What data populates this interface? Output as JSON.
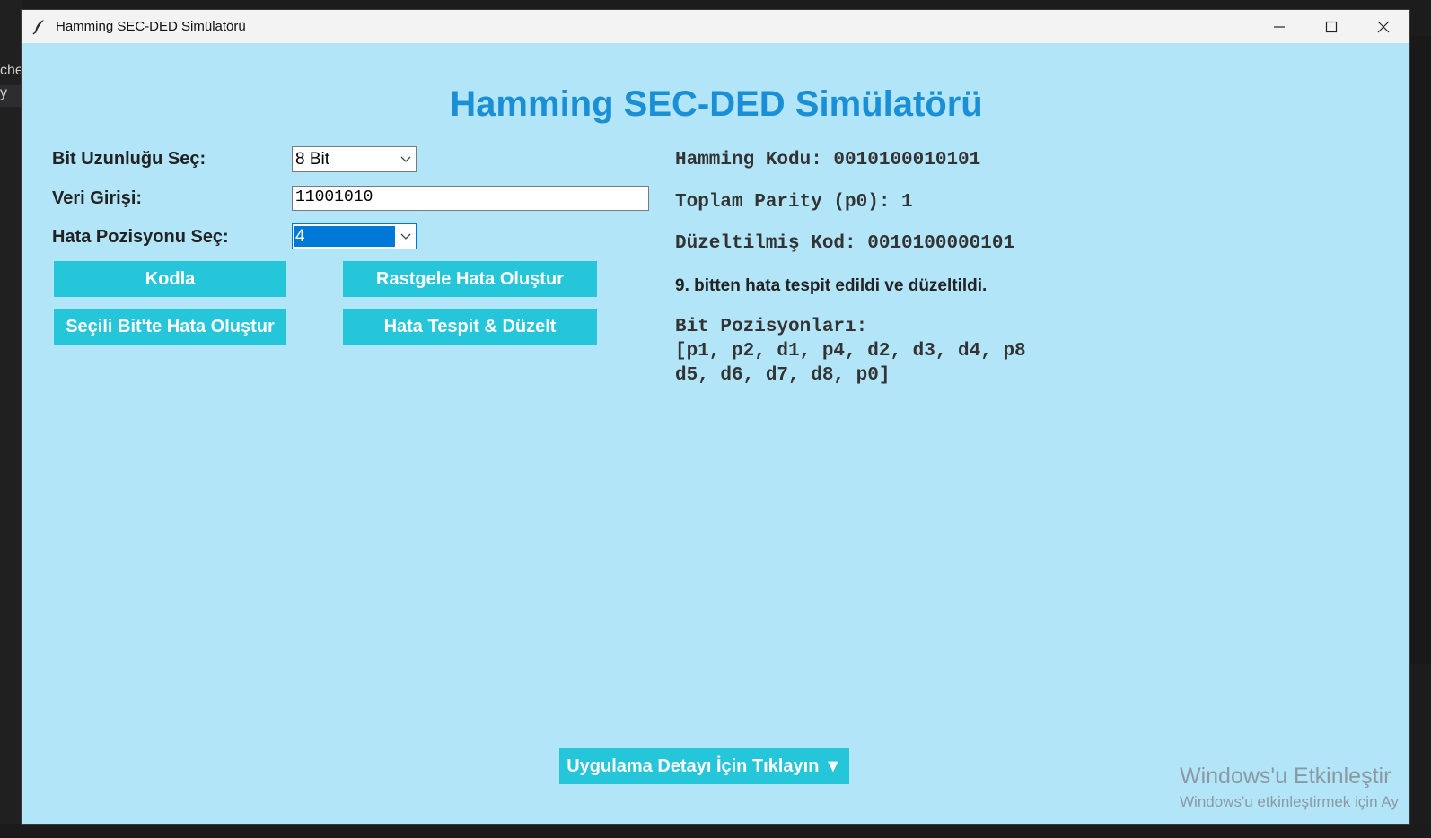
{
  "background": {
    "left_text_1": "che",
    "left_text_2": "y"
  },
  "window": {
    "title": "Hamming SEC-DED Simülatörü"
  },
  "main": {
    "heading": "Hamming SEC-DED Simülatörü",
    "bit_length_label": "Bit Uzunluğu Seç:",
    "bit_length_value": "8 Bit",
    "data_input_label": "Veri Girişi:",
    "data_input_value": "11001010",
    "error_position_label": "Hata Pozisyonu Seç:",
    "error_position_value": "4",
    "buttons": {
      "encode": "Kodla",
      "random_error": "Rastgele Hata Oluştur",
      "selected_bit_error": "Seçili Bit'te Hata Oluştur",
      "detect_correct": "Hata Tespit & Düzelt"
    },
    "output": {
      "hamming_code": "Hamming Kodu: 0010100010101",
      "total_parity": "Toplam Parity (p0): 1",
      "corrected_code": "Düzeltilmiş Kod: 0010100000101",
      "message": "9. bitten hata tespit edildi ve düzeltildi.",
      "bit_positions_title": "Bit Pozisyonları:",
      "bit_positions_line1": "[p1, p2, d1, p4, d2, d3, d4, p8",
      "bit_positions_line2": "d5, d6, d7, d8, p0]"
    },
    "detail_button": "Uygulama Detayı İçin Tıklayın ▼"
  },
  "watermark": {
    "line1": "Windows'u Etkinleştir",
    "line2": "Windows'u etkinleştirmek için Ay"
  },
  "colors": {
    "window_bg": "#b3e5f9",
    "title_color": "#1a8fd6",
    "button_bg": "#26c6da",
    "selection": "#0078d7"
  }
}
